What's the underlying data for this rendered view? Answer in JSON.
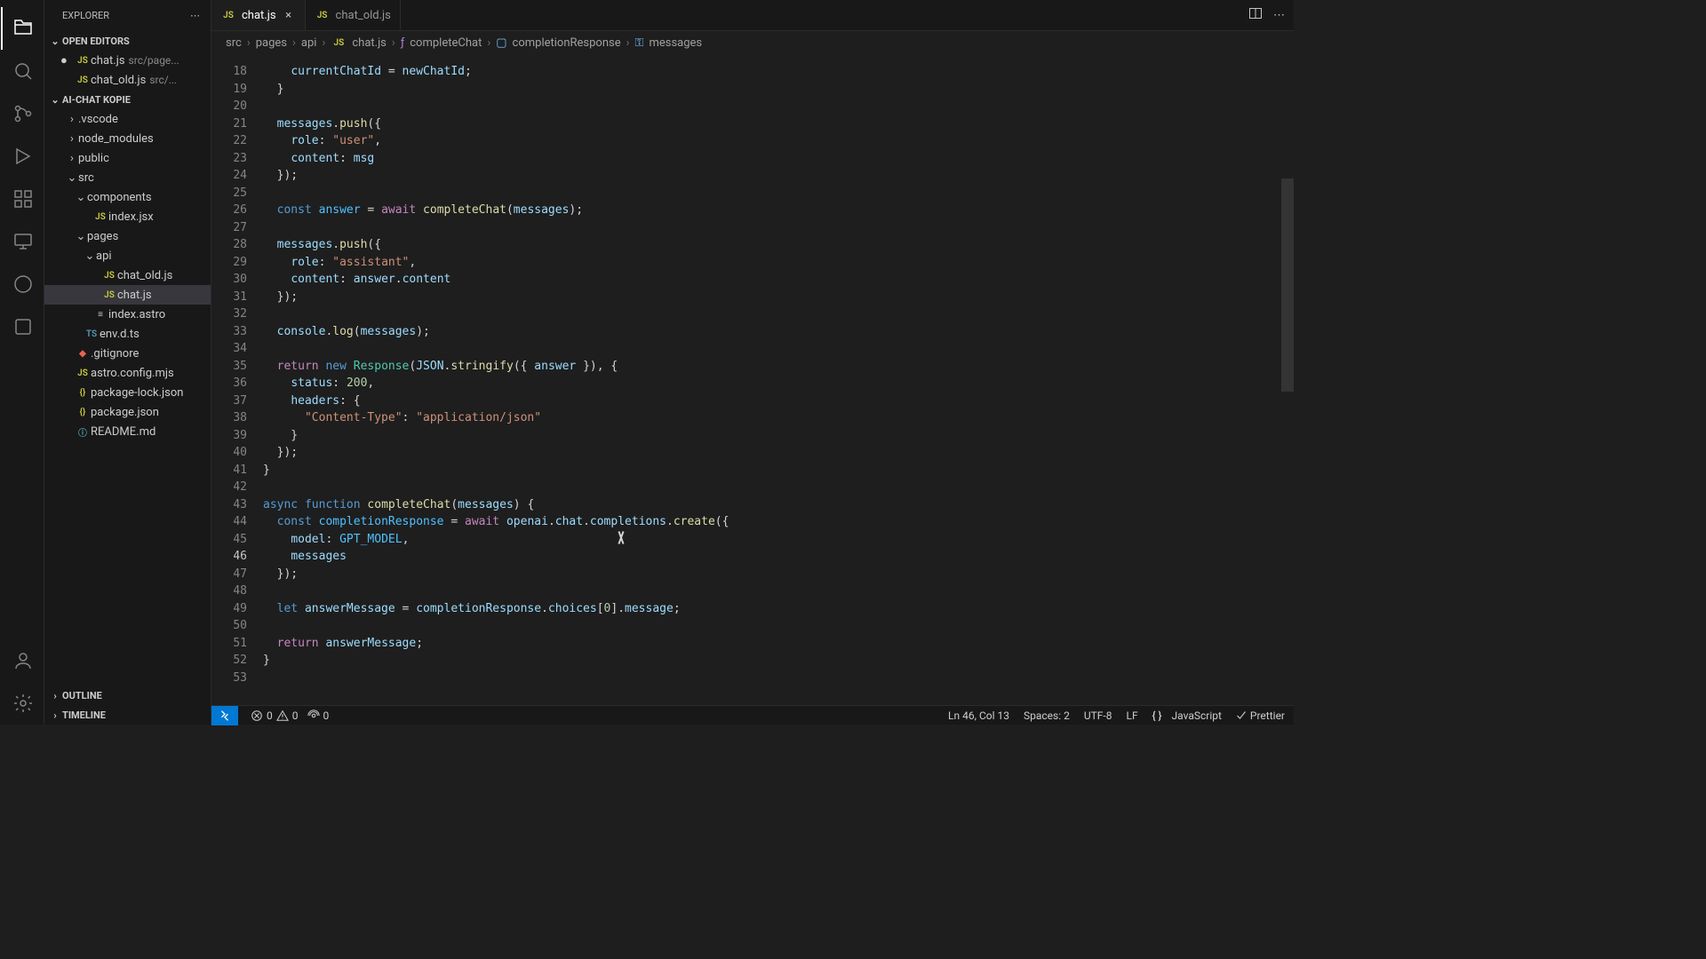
{
  "sidebar": {
    "title": "EXPLORER",
    "openEditors": {
      "label": "OPEN EDITORS",
      "items": [
        {
          "name": "chat.js",
          "path": "src/page...",
          "modified": true
        },
        {
          "name": "chat_old.js",
          "path": "src/...",
          "modified": false
        }
      ]
    },
    "workspace": {
      "label": "AI-CHAT KOPIE",
      "tree": [
        {
          "type": "folder",
          "name": ".vscode",
          "depth": 0,
          "open": false
        },
        {
          "type": "folder",
          "name": "node_modules",
          "depth": 0,
          "open": false
        },
        {
          "type": "folder",
          "name": "public",
          "depth": 0,
          "open": false
        },
        {
          "type": "folder",
          "name": "src",
          "depth": 0,
          "open": true
        },
        {
          "type": "folder",
          "name": "components",
          "depth": 1,
          "open": true
        },
        {
          "type": "file",
          "name": "index.jsx",
          "depth": 2,
          "icon": "js"
        },
        {
          "type": "folder",
          "name": "pages",
          "depth": 1,
          "open": true
        },
        {
          "type": "folder",
          "name": "api",
          "depth": 2,
          "open": true
        },
        {
          "type": "file",
          "name": "chat_old.js",
          "depth": 3,
          "icon": "js"
        },
        {
          "type": "file",
          "name": "chat.js",
          "depth": 3,
          "icon": "js",
          "selected": true
        },
        {
          "type": "file",
          "name": "index.astro",
          "depth": 2,
          "icon": "astro"
        },
        {
          "type": "file",
          "name": "env.d.ts",
          "depth": 1,
          "icon": "ts"
        },
        {
          "type": "file",
          "name": ".gitignore",
          "depth": 0,
          "icon": "git"
        },
        {
          "type": "file",
          "name": "astro.config.mjs",
          "depth": 0,
          "icon": "js"
        },
        {
          "type": "file",
          "name": "package-lock.json",
          "depth": 0,
          "icon": "json"
        },
        {
          "type": "file",
          "name": "package.json",
          "depth": 0,
          "icon": "json"
        },
        {
          "type": "file",
          "name": "README.md",
          "depth": 0,
          "icon": "md"
        }
      ]
    },
    "outline": "OUTLINE",
    "timeline": "TIMELINE"
  },
  "tabs": [
    {
      "name": "chat.js",
      "active": true,
      "icon": "js"
    },
    {
      "name": "chat_old.js",
      "active": false,
      "icon": "js"
    }
  ],
  "breadcrumbs": [
    "src",
    "pages",
    "api",
    "chat.js",
    "completeChat",
    "completionResponse",
    "messages"
  ],
  "editor": {
    "startLine": 18,
    "currentLine": 46,
    "lines": [
      {
        "n": 18,
        "html": "    <span class='tok-var'>currentChatId</span> <span class='tok-op'>=</span> <span class='tok-var'>newChatId</span>;"
      },
      {
        "n": 19,
        "html": "  }"
      },
      {
        "n": 20,
        "html": ""
      },
      {
        "n": 21,
        "html": "  <span class='tok-var'>messages</span>.<span class='tok-fn'>push</span>({"
      },
      {
        "n": 22,
        "html": "    <span class='tok-var'>role</span>: <span class='tok-str'>\"user\"</span>,"
      },
      {
        "n": 23,
        "html": "    <span class='tok-var'>content</span>: <span class='tok-var'>msg</span>"
      },
      {
        "n": 24,
        "html": "  });"
      },
      {
        "n": 25,
        "html": ""
      },
      {
        "n": 26,
        "html": "  <span class='tok-kw2'>const</span> <span class='tok-const'>answer</span> <span class='tok-op'>=</span> <span class='tok-kw'>await</span> <span class='tok-fn'>completeChat</span>(<span class='tok-var'>messages</span>);"
      },
      {
        "n": 27,
        "html": ""
      },
      {
        "n": 28,
        "html": "  <span class='tok-var'>messages</span>.<span class='tok-fn'>push</span>({"
      },
      {
        "n": 29,
        "html": "    <span class='tok-var'>role</span>: <span class='tok-str'>\"assistant\"</span>,"
      },
      {
        "n": 30,
        "html": "    <span class='tok-var'>content</span>: <span class='tok-var'>answer</span>.<span class='tok-var'>content</span>"
      },
      {
        "n": 31,
        "html": "  });"
      },
      {
        "n": 32,
        "html": ""
      },
      {
        "n": 33,
        "html": "  <span class='tok-var'>console</span>.<span class='tok-fn'>log</span>(<span class='tok-var'>messages</span>);"
      },
      {
        "n": 34,
        "html": ""
      },
      {
        "n": 35,
        "html": "  <span class='tok-kw'>return</span> <span class='tok-kw2'>new</span> <span class='tok-type'>Response</span>(<span class='tok-var'>JSON</span>.<span class='tok-fn'>stringify</span>({ <span class='tok-var'>answer</span> }), {"
      },
      {
        "n": 36,
        "html": "    <span class='tok-var'>status</span>: <span class='tok-num'>200</span>,"
      },
      {
        "n": 37,
        "html": "    <span class='tok-var'>headers</span>: {"
      },
      {
        "n": 38,
        "html": "      <span class='tok-str'>\"Content-Type\"</span>: <span class='tok-str'>\"application/json\"</span>"
      },
      {
        "n": 39,
        "html": "    }"
      },
      {
        "n": 40,
        "html": "  });"
      },
      {
        "n": 41,
        "html": "}"
      },
      {
        "n": 42,
        "html": ""
      },
      {
        "n": 43,
        "html": "<span class='tok-kw2'>async</span> <span class='tok-kw2'>function</span> <span class='tok-fn'>completeChat</span>(<span class='tok-param'>messages</span>) {"
      },
      {
        "n": 44,
        "html": "  <span class='tok-kw2'>const</span> <span class='tok-const'>completionResponse</span> <span class='tok-op'>=</span> <span class='tok-kw'>await</span> <span class='tok-var'>openai</span>.<span class='tok-var'>chat</span>.<span class='tok-var'>completions</span>.<span class='tok-fn'>create</span>({"
      },
      {
        "n": 45,
        "html": "    <span class='tok-var'>model</span>: <span class='tok-const'>GPT_MODEL</span>,"
      },
      {
        "n": 46,
        "html": "    <span class='tok-var'>messages</span>"
      },
      {
        "n": 47,
        "html": "  });"
      },
      {
        "n": 48,
        "html": ""
      },
      {
        "n": 49,
        "html": "  <span class='tok-kw2'>let</span> <span class='tok-var'>answerMessage</span> <span class='tok-op'>=</span> <span class='tok-var'>completionResponse</span>.<span class='tok-var'>choices</span>[<span class='tok-num'>0</span>].<span class='tok-var'>message</span>;"
      },
      {
        "n": 50,
        "html": ""
      },
      {
        "n": 51,
        "html": "  <span class='tok-kw'>return</span> <span class='tok-var'>answerMessage</span>;"
      },
      {
        "n": 52,
        "html": "}"
      },
      {
        "n": 53,
        "html": ""
      }
    ]
  },
  "statusbar": {
    "errors": "0",
    "warnings": "0",
    "ports": "0",
    "lncol": "Ln 46, Col 13",
    "spaces": "Spaces: 2",
    "encoding": "UTF-8",
    "eol": "LF",
    "lang": "JavaScript",
    "prettier": "Prettier"
  }
}
